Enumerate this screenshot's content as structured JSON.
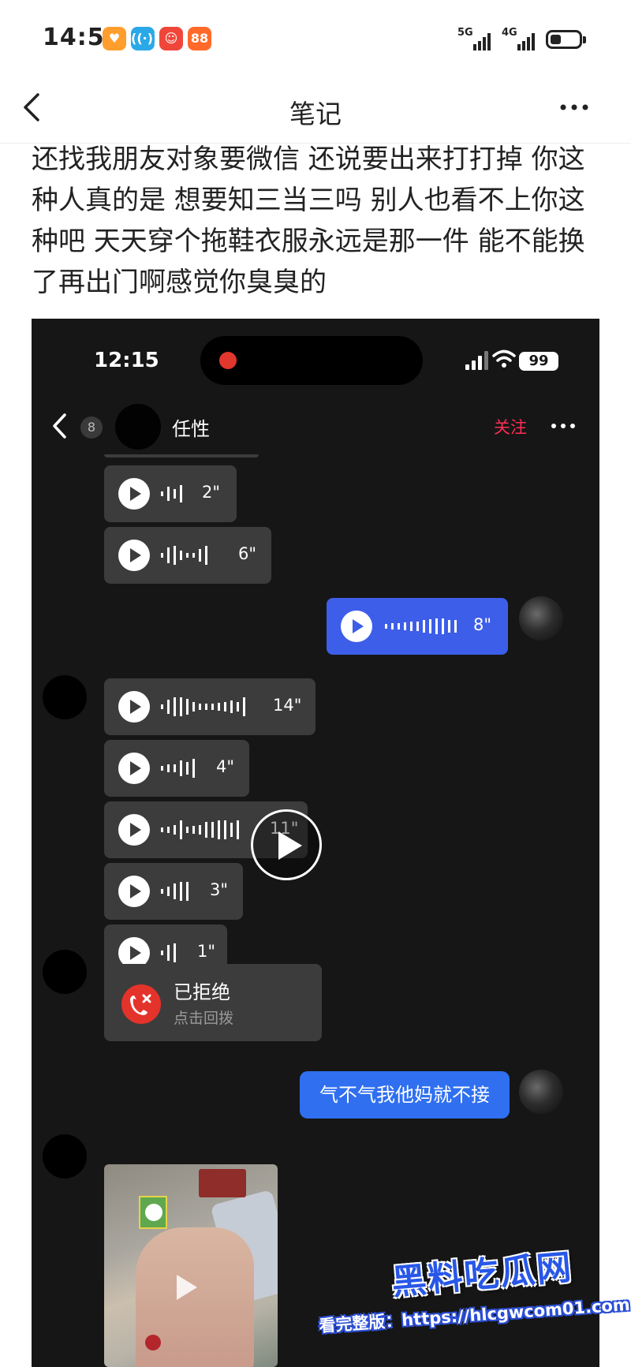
{
  "status_bar": {
    "time": "14:54",
    "network_1": "5G",
    "network_2": "4G",
    "app_icons": [
      "heart-app-icon",
      "signal-app-icon",
      "clown-app-icon",
      "grid-app-icon"
    ]
  },
  "nav": {
    "title": "笔记",
    "back_icon": "chevron-left-icon",
    "more_icon": "more-dots-icon"
  },
  "note": {
    "body": "还找我朋友对象要微信 还说要出来打打掉 你这种人真的是 想要知三当三吗 别人也看不上你这种吧 天天穿个拖鞋衣服永远是那一件 能不能换了再出门啊感觉你臭臭的"
  },
  "screenshot": {
    "time": "12:15",
    "battery": "99",
    "header": {
      "unread_badge": "8",
      "contact_name": "任性",
      "follow_label": "关注"
    },
    "voice_messages": [
      {
        "duration": "2\"",
        "sender": "other"
      },
      {
        "duration": "6\"",
        "sender": "other"
      },
      {
        "duration": "8\"",
        "sender": "me"
      },
      {
        "duration": "14\"",
        "sender": "other"
      },
      {
        "duration": "4\"",
        "sender": "other"
      },
      {
        "duration": "11\"",
        "sender": "other"
      },
      {
        "duration": "3\"",
        "sender": "other"
      },
      {
        "duration": "1\"",
        "sender": "other"
      }
    ],
    "call": {
      "title": "已拒绝",
      "subtitle": "点击回拨"
    },
    "text_message": "气不气我他妈就不接"
  },
  "watermark": {
    "logo": "黑料吃瓜网",
    "url_text": "看完整版：https://hlcgwcom01.com"
  },
  "colors": {
    "accent_blue": "#3d5ee8",
    "follow_red": "#ff2d55",
    "decline_red": "#e4332a",
    "bubble_gray": "#3c3c3c",
    "chat_bg": "#161616"
  }
}
